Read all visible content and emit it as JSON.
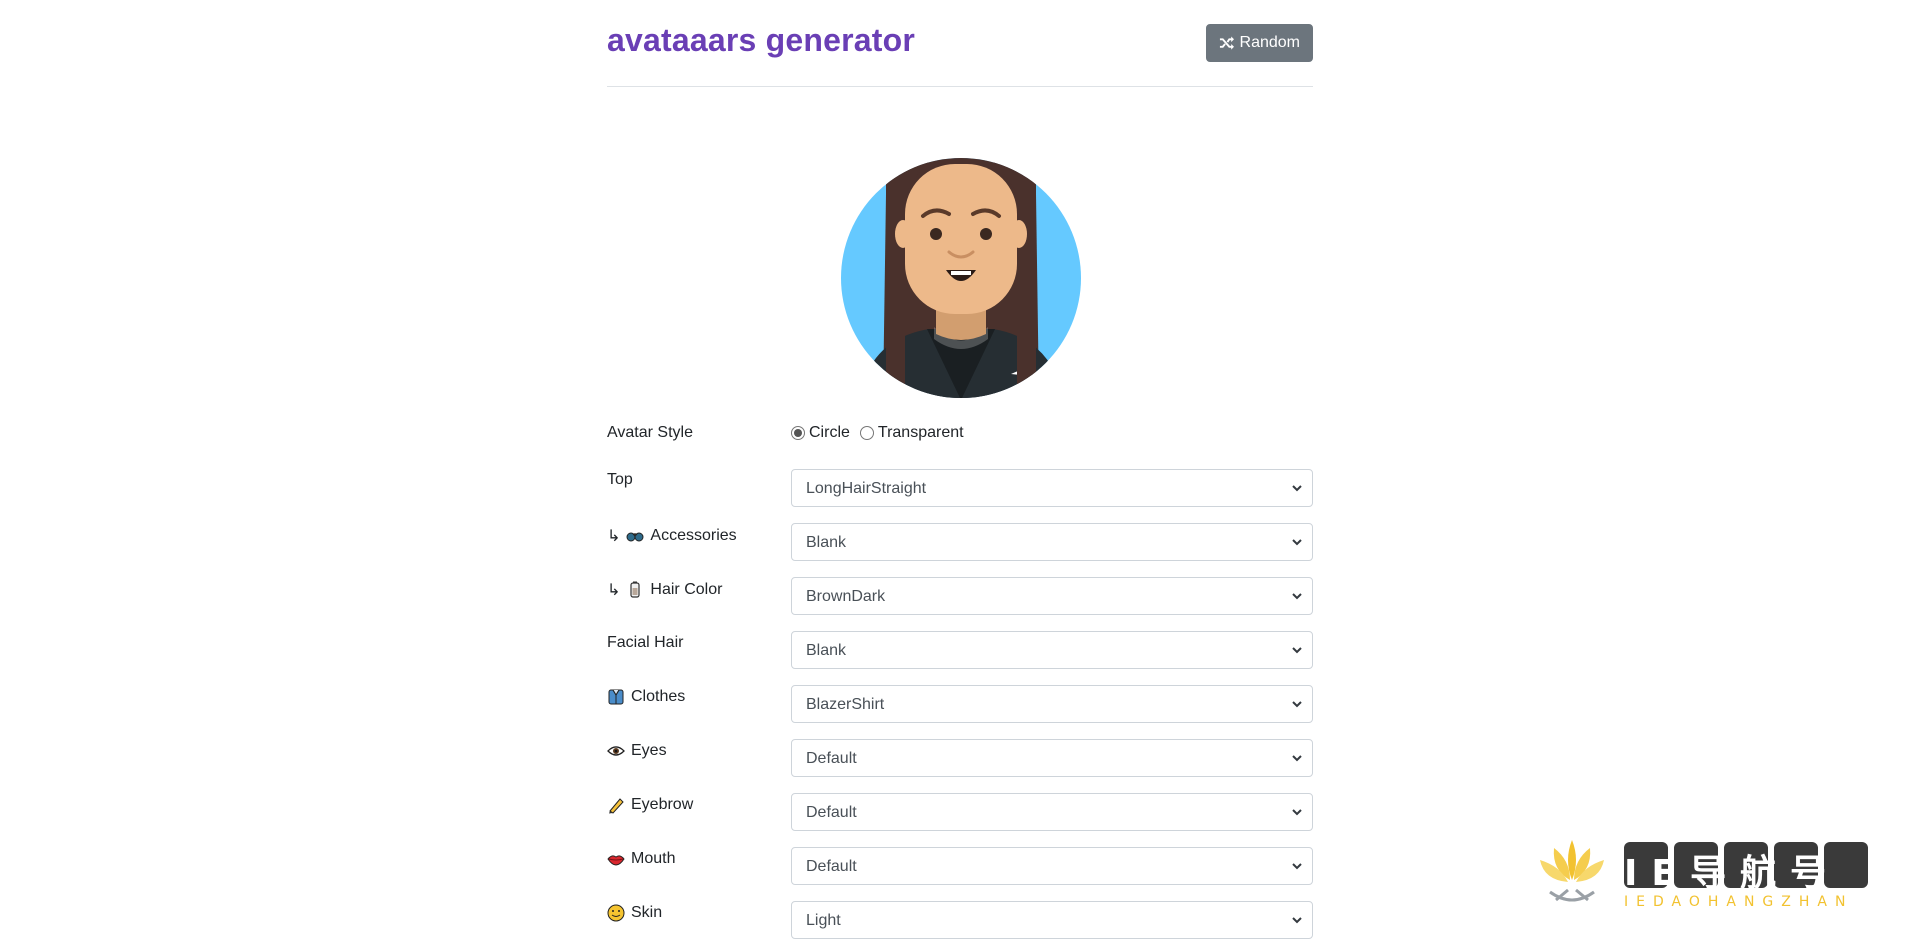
{
  "header": {
    "title": "avataaars generator",
    "random_label": "Random",
    "random_icon": "shuffle-icon"
  },
  "avatar": {
    "background_color": "#65c9ff",
    "hair_color": "#4a312c",
    "skin_color": "#edb98a",
    "clothes_color": "#262e33"
  },
  "avatar_style": {
    "label": "Avatar Style",
    "options": [
      "Circle",
      "Transparent"
    ],
    "selected": "Circle"
  },
  "fields": [
    {
      "label": "Top",
      "prefix": "",
      "icon": "",
      "value": "LongHairStraight"
    },
    {
      "label": "Accessories",
      "prefix": "↳",
      "icon": "glasses-icon",
      "value": "Blank"
    },
    {
      "label": "Hair Color",
      "prefix": "↳",
      "icon": "paint-tube-icon",
      "value": "BrownDark"
    },
    {
      "label": "Facial Hair",
      "prefix": "",
      "icon": "",
      "value": "Blank"
    },
    {
      "label": "Clothes",
      "prefix": "",
      "icon": "shirt-icon",
      "value": "BlazerShirt"
    },
    {
      "label": "Eyes",
      "prefix": "",
      "icon": "eye-icon",
      "value": "Default"
    },
    {
      "label": "Eyebrow",
      "prefix": "",
      "icon": "pencil-icon",
      "value": "Default"
    },
    {
      "label": "Mouth",
      "prefix": "",
      "icon": "lips-icon",
      "value": "Default"
    },
    {
      "label": "Skin",
      "prefix": "",
      "icon": "skin-tone-icon",
      "value": "Light"
    }
  ],
  "watermark": {
    "text": "IE导航号",
    "subtext": "IEDAOHANGZHAN"
  }
}
